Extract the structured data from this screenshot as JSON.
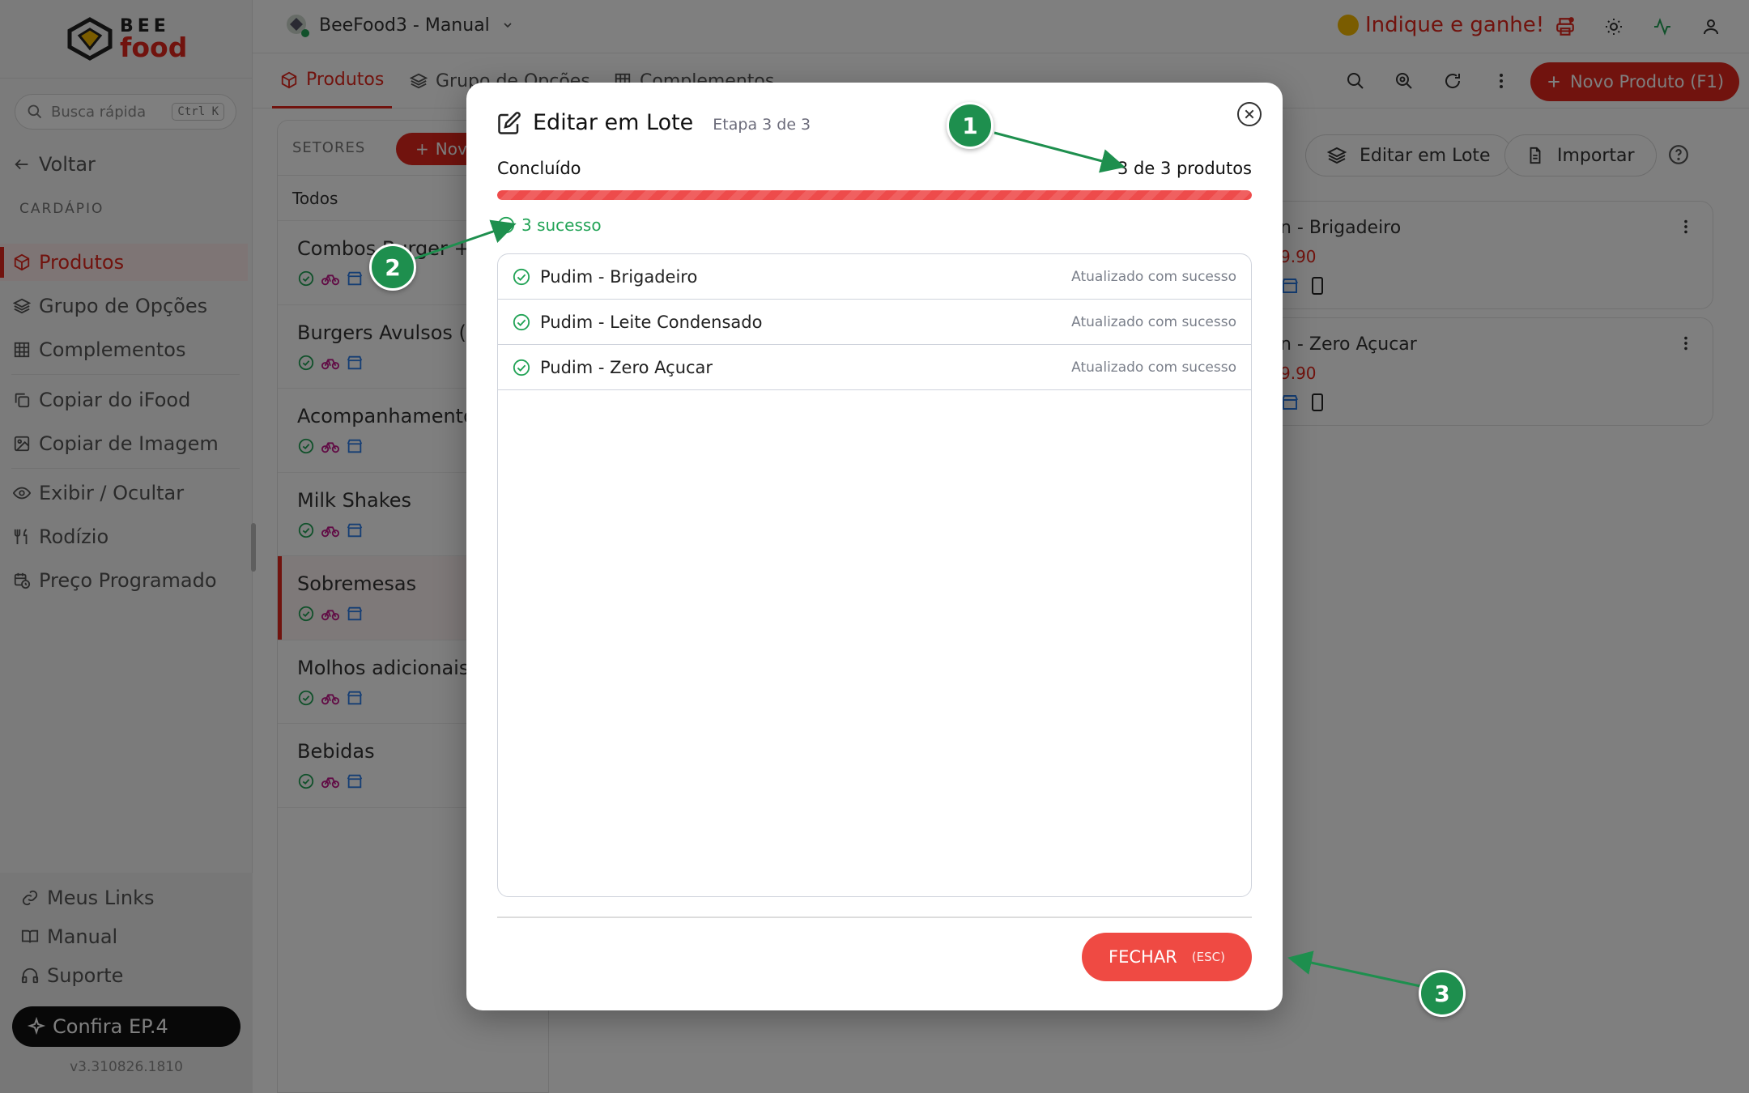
{
  "logo": {
    "line1": "BEE",
    "line2": "food"
  },
  "sidebar": {
    "search": {
      "label": "Busca rápida",
      "shortcut": "Ctrl K"
    },
    "back": "Voltar",
    "section": "CARDÁPIO",
    "items": [
      {
        "label": "Produtos",
        "icon": "box-icon",
        "active": true
      },
      {
        "label": "Grupo de Opções",
        "icon": "layers-icon"
      },
      {
        "label": "Complementos",
        "icon": "grid-icon"
      },
      {
        "label": "Copiar do iFood",
        "icon": "copy-icon"
      },
      {
        "label": "Copiar de Imagem",
        "icon": "image-icon"
      },
      {
        "label": "Exibir / Ocultar",
        "icon": "eye-icon"
      },
      {
        "label": "Rodízio",
        "icon": "utensils-icon"
      },
      {
        "label": "Preço Programado",
        "icon": "calendar-clock-icon"
      }
    ],
    "footer": [
      {
        "label": "Meus Links",
        "icon": "link-icon"
      },
      {
        "label": "Manual",
        "icon": "book-icon"
      },
      {
        "label": "Suporte",
        "icon": "headset-icon"
      }
    ],
    "promo": "Confira EP.4",
    "version": "v3.310826.1810"
  },
  "topbar": {
    "store": "BeeFood3 - Manual",
    "referral": "Indique e ganhe!"
  },
  "tabs": [
    {
      "label": "Produtos",
      "active": true
    },
    {
      "label": "Grupo de Opções"
    },
    {
      "label": "Complementos"
    }
  ],
  "new_product": "Novo Produto (F1)",
  "sectors": {
    "header": "SETORES",
    "new_button": "Nov",
    "all": "Todos",
    "items": [
      {
        "name": "Combos Burger +"
      },
      {
        "name": "Burgers Avulsos (S"
      },
      {
        "name": "Acompanhamento"
      },
      {
        "name": "Milk Shakes"
      },
      {
        "name": "Sobremesas",
        "active": true
      },
      {
        "name": "Molhos adicionais"
      },
      {
        "name": "Bebidas"
      }
    ]
  },
  "toolbar": {
    "batch_edit": "Editar em Lote",
    "import": "Importar"
  },
  "product_cards": [
    {
      "name": "n - Brigadeiro",
      "price": "9.90"
    },
    {
      "name": "n - Zero Açucar",
      "price": "9.90"
    }
  ],
  "modal": {
    "title": "Editar em Lote",
    "step": "Etapa 3 de 3",
    "status": "Concluído",
    "count": "3 de 3 produtos",
    "progress_fraction": 1.0,
    "success": "3 sucesso",
    "results": [
      {
        "name": "Pudim - Brigadeiro",
        "status": "Atualizado com sucesso"
      },
      {
        "name": "Pudim - Leite Condensado",
        "status": "Atualizado com sucesso"
      },
      {
        "name": "Pudim - Zero Açucar",
        "status": "Atualizado com sucesso"
      }
    ],
    "close_label": "FECHAR",
    "close_shortcut": "(ESC)"
  },
  "callouts": [
    "1",
    "2",
    "3"
  ],
  "colors": {
    "brand": "#e2261c",
    "success": "#22a356",
    "callout": "#1e8f4e"
  }
}
